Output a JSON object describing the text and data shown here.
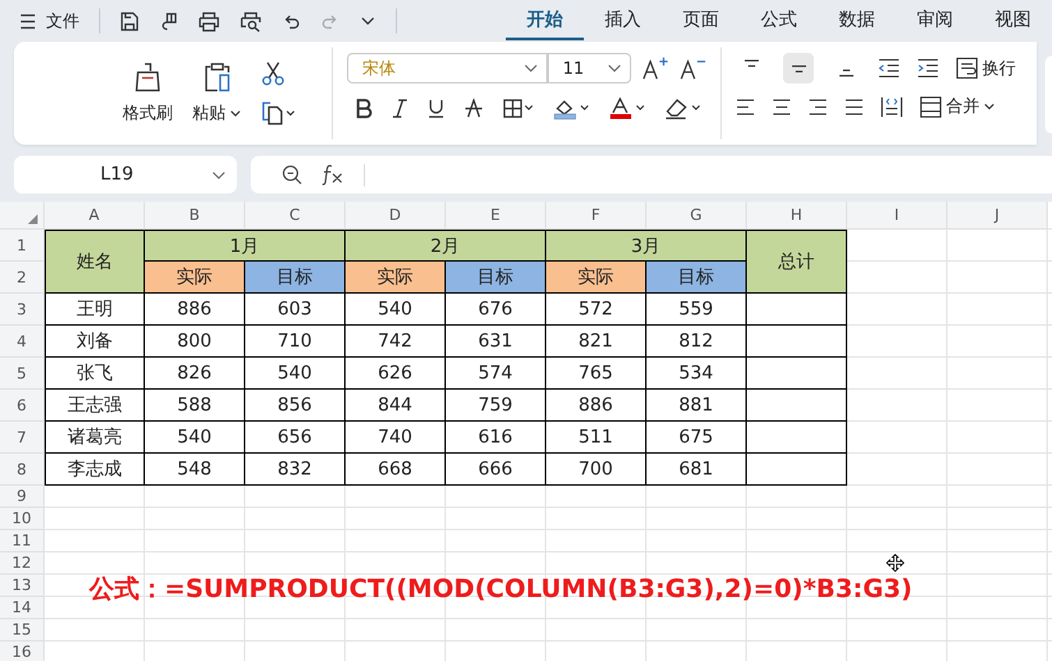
{
  "menu": {
    "file_label": "文件"
  },
  "tabs": [
    {
      "label": "开始",
      "selected": true
    },
    {
      "label": "插入",
      "selected": false
    },
    {
      "label": "页面",
      "selected": false
    },
    {
      "label": "公式",
      "selected": false
    },
    {
      "label": "数据",
      "selected": false
    },
    {
      "label": "审阅",
      "selected": false
    },
    {
      "label": "视图",
      "selected": false
    }
  ],
  "ribbon": {
    "clipboard": {
      "format_painter": "格式刷",
      "paste": "粘贴"
    },
    "font": {
      "name": "宋体",
      "size": "11"
    },
    "alignment": {
      "vertical": [
        {
          "selected": false
        },
        {
          "selected": true
        },
        {
          "selected": false
        }
      ],
      "wrap": "换行",
      "merge": "合并"
    }
  },
  "name_box": "L19",
  "sheet": {
    "columns": [
      "A",
      "B",
      "C",
      "D",
      "E",
      "F",
      "G",
      "H",
      "I",
      "J"
    ],
    "row_numbers": [
      "1",
      "2",
      "3",
      "4",
      "5",
      "6",
      "7",
      "8",
      "9",
      "10",
      "11",
      "12",
      "13",
      "14",
      "15",
      "16"
    ],
    "header": {
      "name": "姓名",
      "total": "总计",
      "months": [
        {
          "label": "1月",
          "subheaders": [
            {
              "label": "实际",
              "color": "#f9bf8f"
            },
            {
              "label": "目标",
              "color": "#8db4e2"
            }
          ]
        },
        {
          "label": "2月",
          "subheaders": [
            {
              "label": "实际",
              "color": "#f9bf8f"
            },
            {
              "label": "目标",
              "color": "#8db4e2"
            }
          ]
        },
        {
          "label": "3月",
          "subheaders": [
            {
              "label": "实际",
              "color": "#f9bf8f"
            },
            {
              "label": "目标",
              "color": "#8db4e2"
            }
          ]
        }
      ]
    },
    "rows": [
      {
        "name": "王明",
        "values": [
          "886",
          "603",
          "540",
          "676",
          "572",
          "559"
        ]
      },
      {
        "name": "刘备",
        "values": [
          "800",
          "710",
          "742",
          "631",
          "821",
          "812"
        ]
      },
      {
        "name": "张飞",
        "values": [
          "826",
          "540",
          "626",
          "574",
          "765",
          "534"
        ]
      },
      {
        "name": "王志强",
        "values": [
          "588",
          "856",
          "844",
          "759",
          "886",
          "881"
        ]
      },
      {
        "name": "诸葛亮",
        "values": [
          "540",
          "656",
          "740",
          "616",
          "511",
          "675"
        ]
      },
      {
        "name": "李志成",
        "values": [
          "548",
          "832",
          "668",
          "666",
          "700",
          "681"
        ]
      }
    ]
  },
  "annotation": "公式：=SUMPRODUCT((MOD(COLUMN(B3:G3),2)=0)*B3:G3)"
}
